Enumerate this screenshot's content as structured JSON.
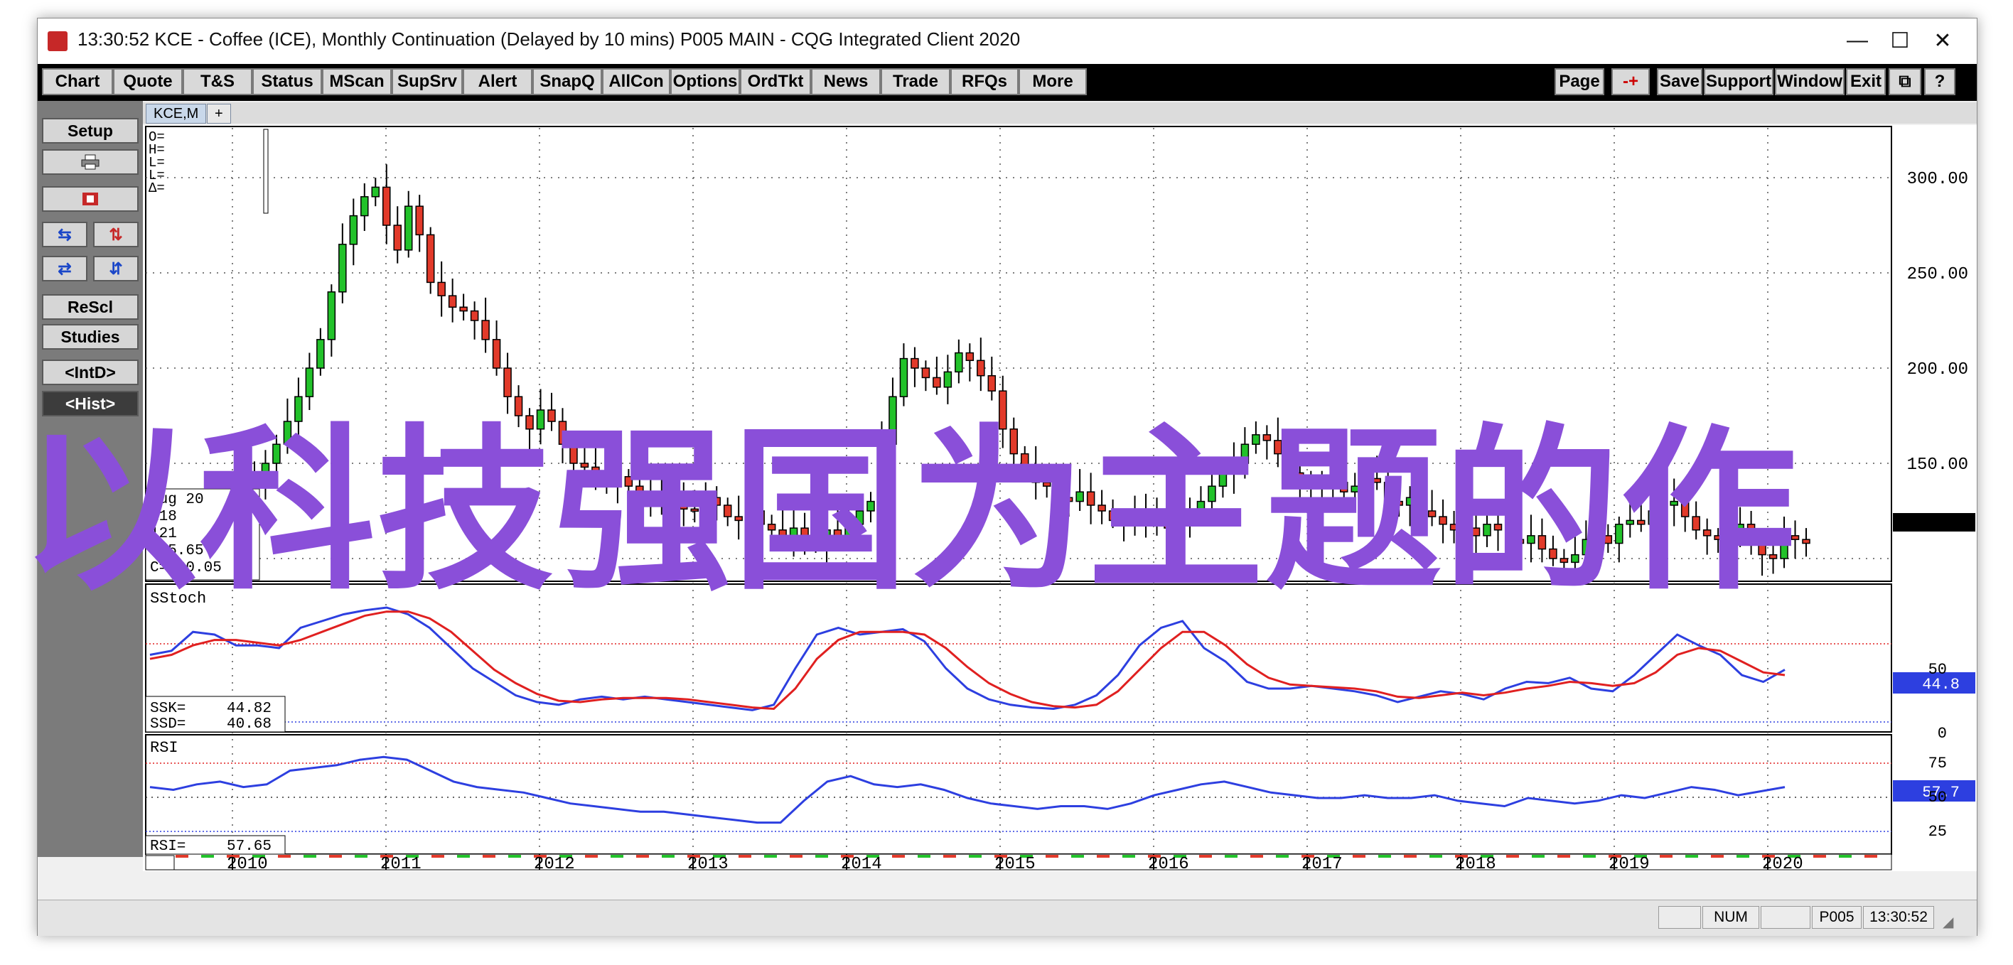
{
  "window": {
    "title": "13:30:52   KCE - Coffee (ICE), Monthly Continuation (Delayed by 10 mins)   P005 MAIN - CQG Integrated Client 2020",
    "minimize": "—",
    "maximize": "☐",
    "close": "✕"
  },
  "toolbar": {
    "left": [
      "Chart",
      "Quote",
      "T&S",
      "Status",
      "MScan",
      "SupSrv",
      "Alert",
      "SnapQ",
      "AllCon",
      "Options",
      "OrdTkt",
      "News",
      "Trade",
      "RFQs",
      "More"
    ],
    "right": [
      "Page",
      "-+",
      "Save",
      "Support",
      "Window",
      "Exit",
      "⧉",
      "?"
    ]
  },
  "sidebar": {
    "setup": "Setup",
    "print_icon": "printer-icon",
    "reset_icon": "reset-icon",
    "rescl": "ReScl",
    "studies": "Studies",
    "intd": "<IntD>",
    "hist": "<Hist>"
  },
  "tabs": {
    "active": "KCE,M",
    "add": "+"
  },
  "ohlc_box": {
    "o": "O=",
    "h": "H=",
    "l1": "L=",
    "l2": "L=",
    "delta": "Δ="
  },
  "cursor_box": {
    "date": "Aug 20",
    "v1": "118",
    "v2": "121",
    "v3": "115.65",
    "close": "C=  20.05"
  },
  "price_axis": [
    "300.00",
    "250.00",
    "200.00",
    "150.00"
  ],
  "price_last": "",
  "stoch": {
    "title": "SStoch",
    "ssk_label": "SSK=",
    "ssk_value": "44.82",
    "ssd_label": "SSD=",
    "ssd_value": "40.68",
    "last": "44.8",
    "axis": [
      "50",
      "0"
    ]
  },
  "rsi": {
    "title": "RSI",
    "label": "RSI=",
    "value": "57.65",
    "last": "57.7",
    "axis": [
      "75",
      "50",
      "25"
    ]
  },
  "years": [
    "2010",
    "2011",
    "2012",
    "2013",
    "2014",
    "2015",
    "2016",
    "2017",
    "2018",
    "2019",
    "2020"
  ],
  "colors": {
    "up": "#22c22a",
    "down": "#e23a2a",
    "ssk": "#2d3fe0",
    "ssd": "#e02020",
    "rsi": "#2d3fe0",
    "last_box": "#2d3fe0",
    "overlay": "#8a4fd9"
  },
  "status": {
    "num": "NUM",
    "page": "P005",
    "time": "13:30:52"
  },
  "overlay_text": "以科技强国为主题的作"
}
